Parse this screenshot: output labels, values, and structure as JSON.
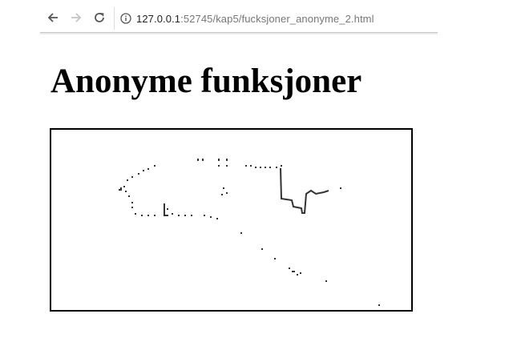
{
  "browser": {
    "url_host": "127.0.0.1",
    "url_rest": ":52745/kap5/fucksjoner_anonyme_2.html"
  },
  "page": {
    "heading": "Anonyme funksjoner"
  },
  "icons": {
    "back": "arrow-left",
    "forward": "arrow-right",
    "reload": "circular-arrow",
    "info": "info-circle"
  },
  "colors": {
    "heading": "#000000",
    "canvas_border": "#000000",
    "drawing": "#333333",
    "forward_disabled": "#c4c4c4",
    "nav_active": "#555555"
  }
}
